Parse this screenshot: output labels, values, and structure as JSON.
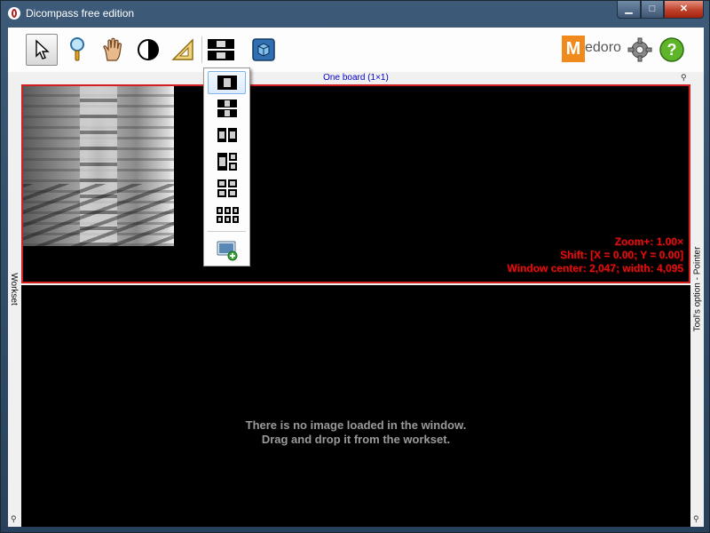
{
  "window": {
    "title": "Dicompass free edition",
    "min_glyph": "▁",
    "max_glyph": "□",
    "close_glyph": "✕"
  },
  "toolbar": {
    "tools": [
      {
        "name": "pointer",
        "icon": "pointer-icon",
        "active": true
      },
      {
        "name": "zoom",
        "icon": "magnifier-icon"
      },
      {
        "name": "pan",
        "icon": "hand-icon"
      },
      {
        "name": "window-level",
        "icon": "contrast-icon"
      },
      {
        "name": "measure",
        "icon": "set-square-icon"
      },
      {
        "name": "layout",
        "icon": "layout-icon"
      },
      {
        "name": "3d",
        "icon": "cube-icon"
      }
    ],
    "brand_m": "M",
    "brand_rest": "edoro",
    "settings_icon": "gear-icon",
    "help_icon": "help-icon"
  },
  "board_label": "One board (1×1)",
  "side_panels": {
    "left": "Workset",
    "right": "Tool's option - Pointer"
  },
  "viewer": {
    "zoom": "Zoom+: 1.00×",
    "shift": "Shift: [X = 0.00; Y = 0.00]",
    "window": "Window center: 2,047; width: 4,095",
    "empty_line1": "There is no image loaded in the window.",
    "empty_line2": "Drag and drop it from the workset."
  },
  "layout_menu": {
    "items": [
      "1x1",
      "1x2",
      "2x1",
      "1+2",
      "2x2",
      "3x2",
      "add-layout"
    ],
    "selected": "1x1"
  },
  "colors": {
    "accent_red": "#d12020",
    "brand_orange": "#f08a1c",
    "link_blue": "#0000cc"
  }
}
